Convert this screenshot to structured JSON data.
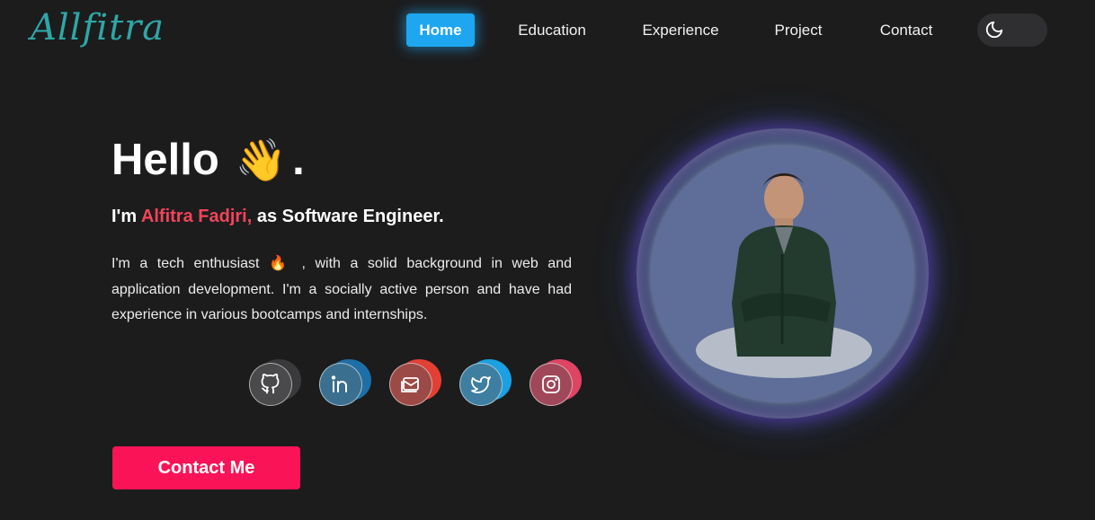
{
  "brand": {
    "logo_text": "Allfitra"
  },
  "nav": {
    "items": [
      {
        "label": "Home",
        "active": true
      },
      {
        "label": "Education",
        "active": false
      },
      {
        "label": "Experience",
        "active": false
      },
      {
        "label": "Project",
        "active": false
      },
      {
        "label": "Contact",
        "active": false
      }
    ],
    "theme_toggle_icon": "moon-icon"
  },
  "hero": {
    "greeting": "Hello",
    "greeting_emoji": "👋",
    "greeting_end": ".",
    "intro_prefix": "I'm ",
    "name": "Alfitra Fadjri,",
    "intro_suffix": " as Software Engineer.",
    "bio_part1": "I'm a tech enthusiast ",
    "bio_emoji": "🔥",
    "bio_part2": " , with a solid background in web and application development. I'm a socially active person and have had experience in various bootcamps and internships.",
    "cta_label": "Contact Me"
  },
  "social": [
    {
      "icon": "github-icon",
      "color": "#3a3a3c"
    },
    {
      "icon": "linkedin-icon",
      "color": "#1d6fa6"
    },
    {
      "icon": "mail-icon",
      "color": "#e24034"
    },
    {
      "icon": "twitter-icon",
      "color": "#1ba0e2"
    },
    {
      "icon": "instagram-icon",
      "color": "#df4463"
    }
  ],
  "colors": {
    "accent_nav": "#1ea7f0",
    "name_color": "#f1445a",
    "cta_bg": "#fa1356",
    "logo_color": "#2fa6a6"
  }
}
